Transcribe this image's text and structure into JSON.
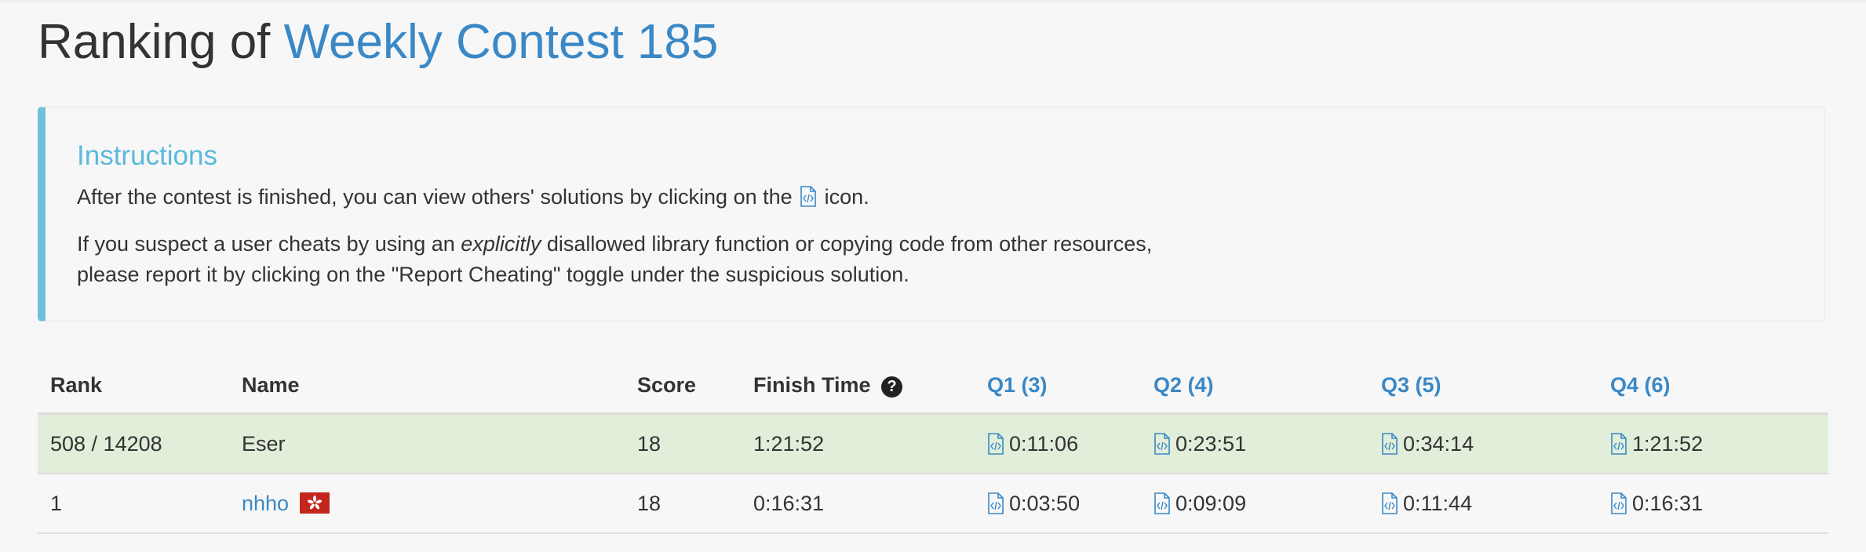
{
  "page": {
    "title_prefix": "Ranking of",
    "title_link": "Weekly Contest 185"
  },
  "instructions": {
    "heading": "Instructions",
    "p1_before_icon": "After the contest is finished, you can view others' solutions by clicking on the",
    "p1_after_icon": "icon.",
    "p2_part1": "If you suspect a user cheats by using an",
    "p2_emphasis": "explicitly",
    "p2_part2": "disallowed library function or copying code from other resources,",
    "p2_line2": "please report it by clicking on the \"Report Cheating\" toggle under the suspicious solution."
  },
  "table": {
    "headers": {
      "rank": "Rank",
      "name": "Name",
      "score": "Score",
      "finish_time": "Finish Time",
      "finish_time_help": "?",
      "q1": "Q1 (3)",
      "q2": "Q2 (4)",
      "q3": "Q3 (5)",
      "q4": "Q4 (6)"
    },
    "rows": [
      {
        "rank": "508 / 14208",
        "name": "Eser",
        "score": "18",
        "finish_time": "1:21:52",
        "q1": "0:11:06",
        "q2": "0:23:51",
        "q3": "0:34:14",
        "q4": "1:21:52"
      },
      {
        "rank": "1",
        "name": "nhho",
        "flag": "hong-kong-flag",
        "score": "18",
        "finish_time": "0:16:31",
        "q1": "0:03:50",
        "q2": "0:09:09",
        "q3": "0:11:44",
        "q4": "0:16:31"
      }
    ]
  },
  "colors": {
    "link": "#3a88c6",
    "instructions_accent": "#6fc0db",
    "highlight_row": "#e1eed9",
    "flag_red": "#c4261d"
  }
}
